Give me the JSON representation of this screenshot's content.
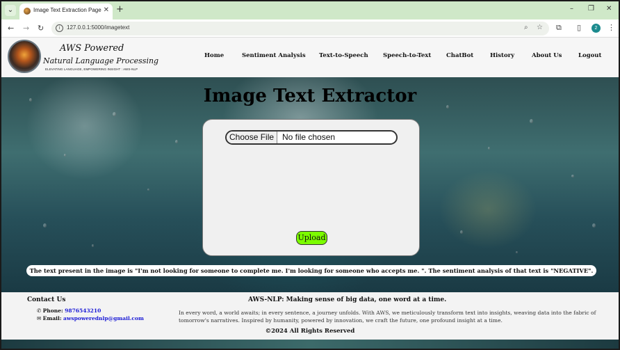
{
  "browser": {
    "tab_title": "Image Text Extraction Page",
    "tab_close": "✕",
    "new_tab": "+",
    "url": "127.0.0.1:5000/imagetext",
    "profile_initial": "2",
    "window_controls": {
      "minimize": "–",
      "maximize": "❐",
      "close": "✕"
    },
    "nav": {
      "back": "←",
      "forward": "→",
      "reload": "↻"
    },
    "icons": {
      "zoom": "search-icon",
      "bookmark": "star-icon",
      "extensions": "puzzle-icon",
      "sidebar": "sidebar-icon",
      "menu": "kebab-menu-icon"
    }
  },
  "site": {
    "brand_top": "AWS Powered",
    "brand_main": "Natural Language Processing",
    "brand_tag": "ELEVATING LANGUAGE, EMPOWERING INSIGHT : AWS-NLP",
    "nav": [
      "Home",
      "Sentiment Analysis",
      "Text-to-Speech",
      "Speech-to-Text",
      "ChatBot",
      "History",
      "About Us",
      "Logout"
    ]
  },
  "main": {
    "title": "Image Text Extractor",
    "file_button": "Choose File",
    "file_status": "No file chosen",
    "upload_label": "Upload",
    "result_text": "The text present in the image is \"I'm not looking for someone to complete me. I'm looking for someone who accepts me. \". The sentiment analysis of that text is \"NEGATIVE\"."
  },
  "footer": {
    "contact_title": "Contact Us",
    "phone_label": "Phone:",
    "phone": "9876543210",
    "email_label": "Email:",
    "email": "awspowerednlp@gmail.com",
    "tagline": "AWS-NLP: Making sense of big data, one word at a time.",
    "description": "In every word, a world awaits; in every sentence, a journey unfolds. With AWS, we meticulously transform text into insights, weaving data into the fabric of tomorrow's narratives. Inspired by humanity, powered by innovation, we craft the future, one profound insight at a time.",
    "copyright": "©2024 All Rights Reserved"
  },
  "colors": {
    "tabbar": "#cfe8c8",
    "upload_button": "#7cfc00",
    "link": "#1a1ad6"
  }
}
